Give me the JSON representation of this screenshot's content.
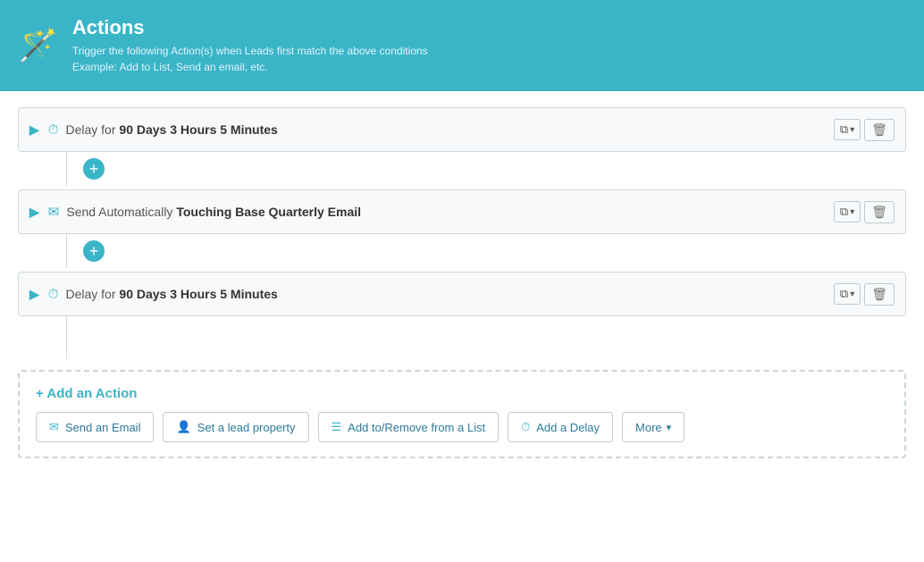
{
  "header": {
    "title": "Actions",
    "subtitle_line1": "Trigger the following Action(s) when Leads first match the above conditions",
    "subtitle_line2": "Example: Add to List, Send an email, etc.",
    "icon": "🪄"
  },
  "actions": [
    {
      "id": "action-1",
      "type": "delay",
      "icon": "⏱",
      "label_prefix": "Delay for ",
      "label_bold_1": "90 Days",
      "label_between": " ",
      "label_bold_2": "3 Hours",
      "label_between2": " ",
      "label_bold_3": "5 Minutes",
      "full_label": "Delay for 90 Days 3 Hours 5 Minutes"
    },
    {
      "id": "action-2",
      "type": "email",
      "icon": "✉",
      "label_prefix": "Send Automatically ",
      "label_bold": "Touching Base Quarterly Email",
      "full_label": "Send Automatically Touching Base Quarterly Email"
    },
    {
      "id": "action-3",
      "type": "delay",
      "icon": "⏱",
      "label_prefix": "Delay for ",
      "label_bold_1": "90 Days",
      "label_between": " ",
      "label_bold_2": "3 Hours",
      "label_between2": " ",
      "label_bold_3": "5 Minutes",
      "full_label": "Delay for 90 Days 3 Hours 5 Minutes"
    }
  ],
  "add_action": {
    "title": "+ Add an Action",
    "buttons": [
      {
        "id": "send-email",
        "icon": "✉",
        "label": "Send an Email"
      },
      {
        "id": "set-lead-property",
        "icon": "👤",
        "label": "Set a lead property"
      },
      {
        "id": "add-remove-list",
        "icon": "☰",
        "label": "Add to/Remove from a List"
      },
      {
        "id": "add-delay",
        "icon": "⏱",
        "label": "Add a Delay"
      },
      {
        "id": "more",
        "icon": "",
        "label": "More",
        "has_dropdown": true
      }
    ]
  },
  "controls": {
    "copy_label": "📋",
    "delete_label": "🗑"
  }
}
